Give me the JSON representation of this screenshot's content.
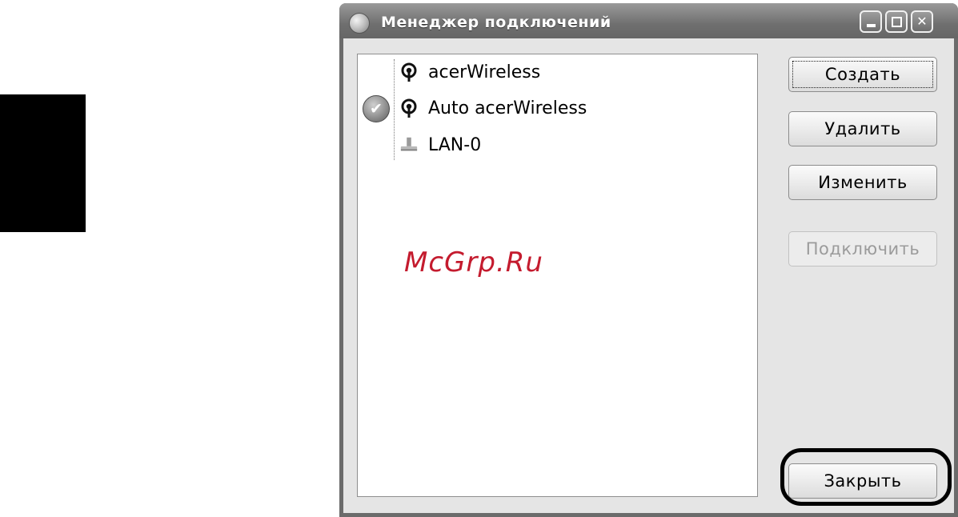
{
  "window": {
    "title": "Менеджер подключений",
    "minimize_label": "",
    "maximize_label": "",
    "close_label": "✕"
  },
  "connections": [
    {
      "name": "acerWireless",
      "type": "wireless",
      "active": false
    },
    {
      "name": "Auto acerWireless",
      "type": "wireless",
      "active": true
    },
    {
      "name": "LAN-0",
      "type": "wired",
      "active": false
    }
  ],
  "active_status_glyph": "✔",
  "watermark": "McGrp.Ru",
  "buttons": {
    "create": "Создать",
    "delete": "Удалить",
    "edit": "Изменить",
    "connect": "Подключить",
    "close": "Закрыть"
  },
  "colors": {
    "titlebar": "#6f6f6f",
    "window_bg": "#e5e5e5",
    "watermark": "#c41b2e",
    "disabled_text": "#9b9b9b"
  }
}
